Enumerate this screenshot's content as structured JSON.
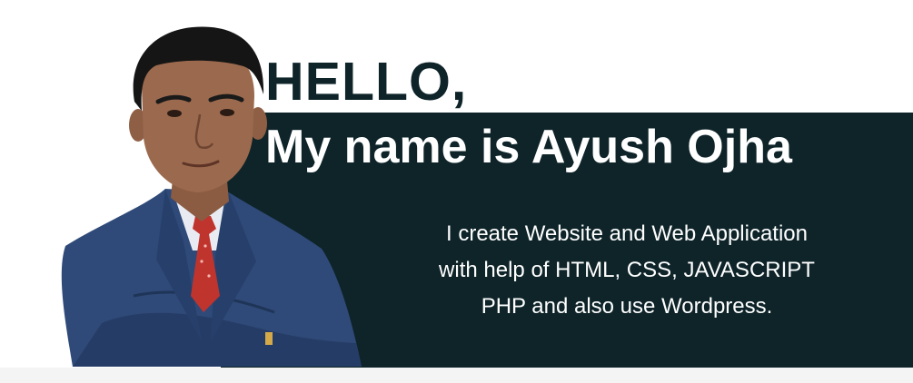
{
  "hero": {
    "greeting": "HELLO,",
    "name_line": "My name is Ayush Ojha",
    "description_lines": [
      "I create Website and Web Application",
      "with help of HTML, CSS, JAVASCRIPT",
      "PHP and also use Wordpress."
    ]
  },
  "colors": {
    "panel": "#0e2429",
    "greeting_text": "#0e2429",
    "text_light": "#ffffff",
    "suit": "#2f4a78",
    "tie": "#c0342e",
    "skin": "#9b6a4e",
    "hair": "#151515"
  }
}
